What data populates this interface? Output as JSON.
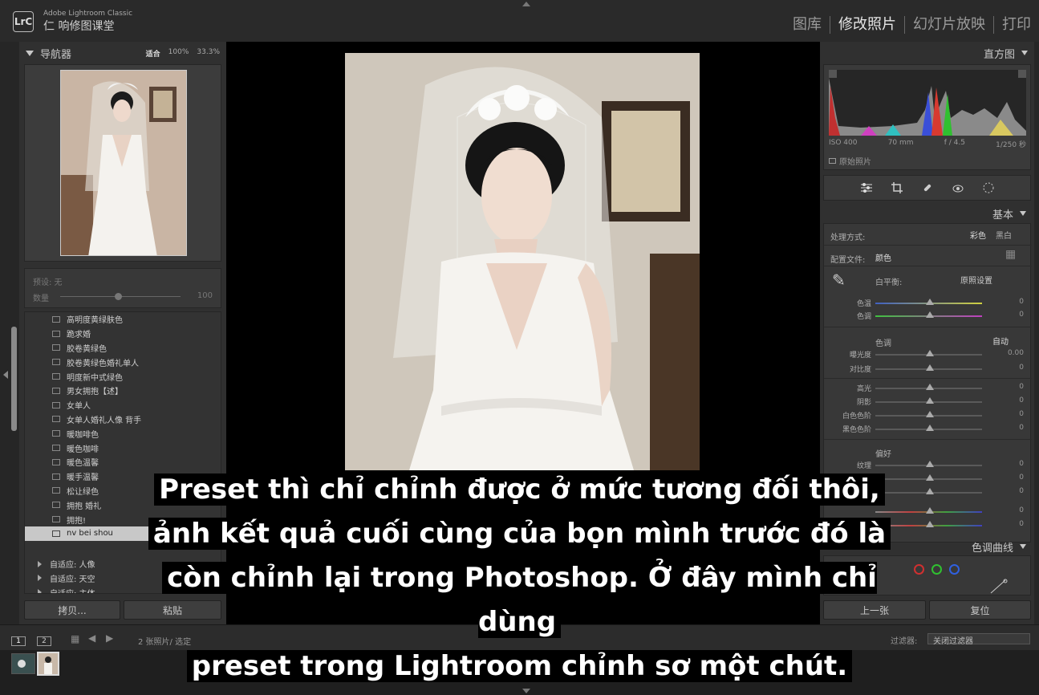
{
  "header": {
    "logo": "LrC",
    "brand_sub": "Adobe Lightroom Classic",
    "brand_main": "仁 响修图课堂",
    "modules": [
      "图库",
      "修改照片",
      "幻灯片放映",
      "打印"
    ]
  },
  "navigator": {
    "title": "导航器",
    "zoom_fit": "适合",
    "zoom_100": "100%",
    "zoom_33": "33.3%"
  },
  "preset_amount": {
    "label_preset": "预设: 无",
    "label_amount": "数量",
    "value": "100"
  },
  "presets": [
    "高明度黄绿肤色",
    "跪求婚",
    "胶卷黄绿色",
    "胶卷黄绿色婚礼单人",
    "明度新中式绿色",
    "男女拥抱【述】",
    "女单人",
    "女单人婚礼人像 背手",
    "暖咖啡色",
    "暖色咖啡",
    "暖色温馨",
    "暖手温馨",
    "松让绿色",
    "拥抱 婚礼",
    "拥抱!",
    "nv bei shou"
  ],
  "preset_folders": [
    "自适应: 人像",
    "自适应: 天空",
    "自适应: 主体"
  ],
  "left_buttons": {
    "copy": "拷贝...",
    "paste": "粘贴"
  },
  "histogram": {
    "title": "直方图",
    "iso": "ISO 400",
    "focal": "70 mm",
    "aperture": "f / 4.5",
    "shutter": "1/250 秒",
    "original_label": "原始照片"
  },
  "basic": {
    "title": "基本",
    "treatment_label": "处理方式:",
    "treatment_color": "彩色",
    "treatment_bw": "黑白",
    "profile_label": "配置文件:",
    "profile_value": "颜色",
    "wb_label": "白平衡:",
    "wb_value": "原照设置",
    "temp_label": "色温",
    "temp_value": "0",
    "tint_label": "色调",
    "tint_value": "0",
    "tone_label": "色调",
    "auto_label": "自动",
    "exposure_label": "曝光度",
    "exposure_value": "0.00",
    "contrast_label": "对比度",
    "contrast_value": "0",
    "highlights_label": "高光",
    "highlights_value": "0",
    "shadows_label": "阴影",
    "shadows_value": "0",
    "whites_label": "白色色阶",
    "whites_value": "0",
    "blacks_label": "黑色色阶",
    "blacks_value": "0",
    "presence_label": "偏好",
    "texture_label": "纹理",
    "texture_value": "0",
    "clarity_value": "0",
    "dehaze_value": "0",
    "vibrance_value": "0",
    "saturation_value": "0"
  },
  "tone_curve": {
    "title": "色调曲线"
  },
  "right_buttons": {
    "previous": "上一张",
    "reset": "复位"
  },
  "toolbar": {
    "view1": "1",
    "view2": "2",
    "photo_count": "2 张照片/ 选定",
    "filter_label": "过滤器:",
    "filter_value": "关闭过滤器"
  },
  "caption": {
    "line1": "Preset thì chỉ chỉnh được ở mức tương đối thôi,",
    "line2": "ảnh kết quả cuối cùng của bọn mình trước đó là",
    "line3": "còn chỉnh lại trong Photoshop. Ở đây mình chỉ dùng",
    "line4": "preset trong Lightroom chỉnh sơ một chút."
  }
}
